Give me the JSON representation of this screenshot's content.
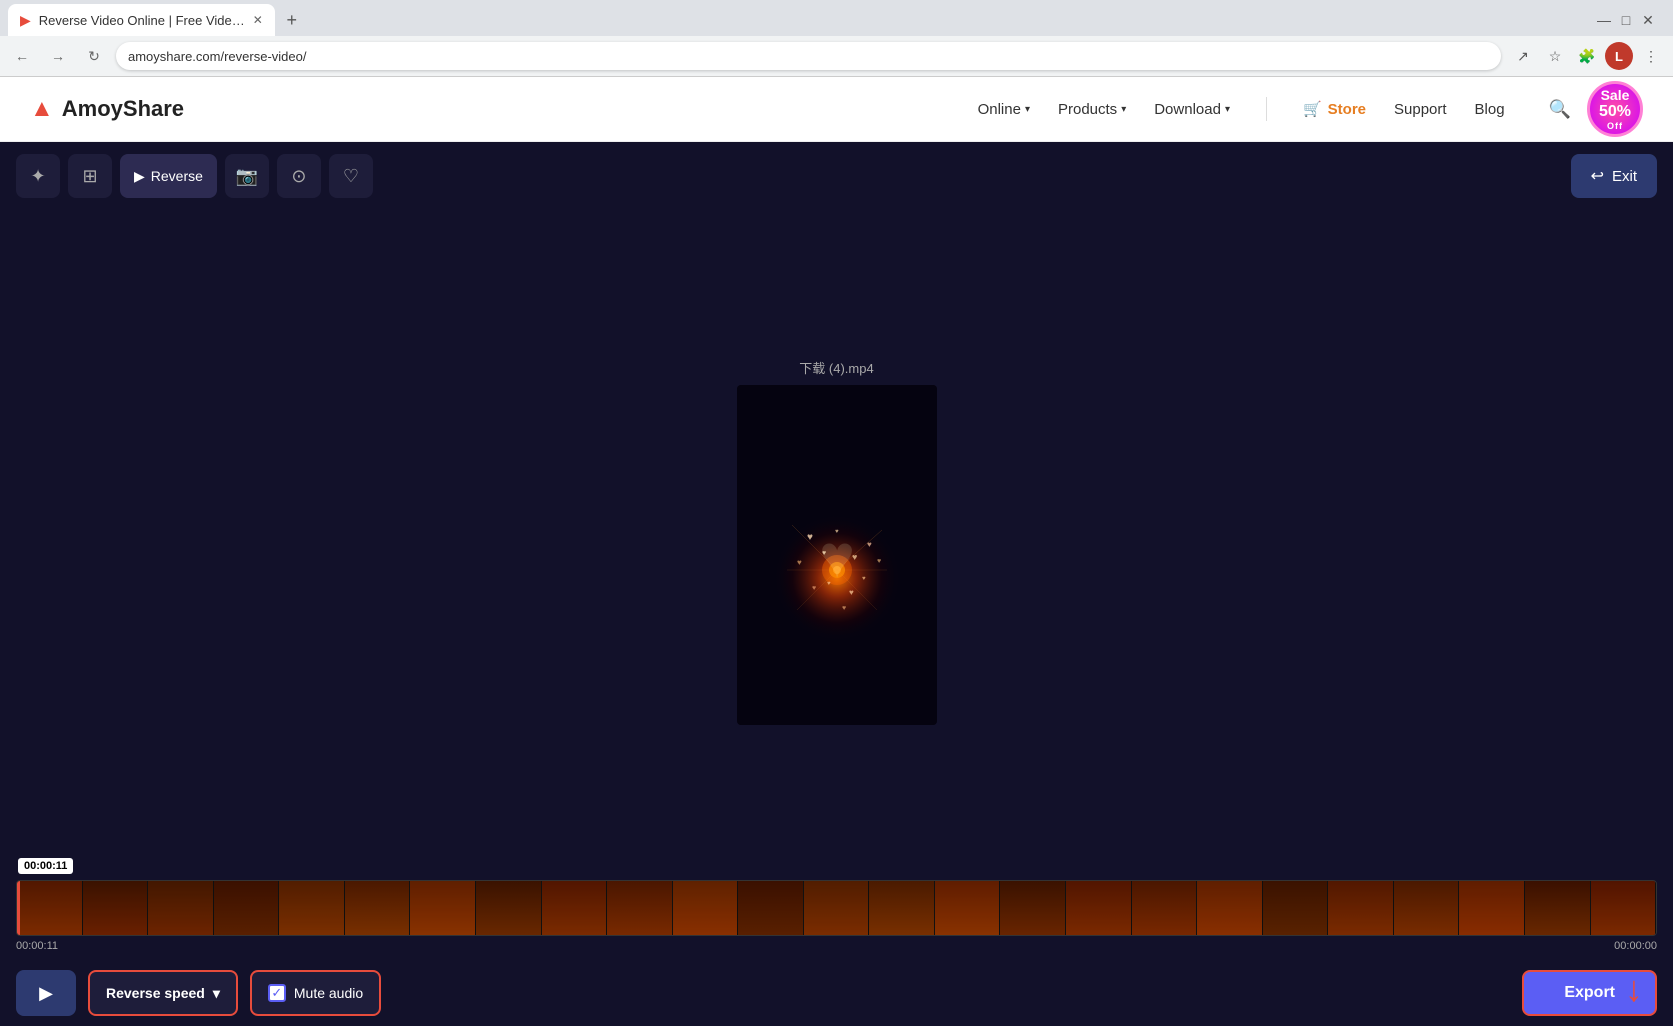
{
  "browser": {
    "tab_title": "Reverse Video Online | Free Vide…",
    "address": "amoyshare.com/reverse-video/",
    "new_tab_label": "+",
    "profile_initial": "L"
  },
  "header": {
    "logo_text": "AmoyShare",
    "nav": {
      "online": "Online",
      "products": "Products",
      "download": "Download",
      "store": "Store",
      "support": "Support",
      "blog": "Blog"
    },
    "sale_text": "Sale",
    "sale_percent": "50%",
    "sale_off": "Off"
  },
  "toolbar": {
    "ai_label": "✦",
    "crop_label": "⊡",
    "reverse_label": "Reverse",
    "screenshot_label": "⎙",
    "record_label": "⊙",
    "favorite_label": "♡",
    "exit_label": "Exit"
  },
  "video": {
    "filename": "下载 (4).mp4"
  },
  "timeline": {
    "start_time": "00:00:11",
    "end_time": "00:00:00",
    "cursor_time": "00:00:11"
  },
  "controls": {
    "reverse_speed_label": "Reverse speed",
    "mute_audio_label": "Mute audio",
    "export_label": "Export"
  }
}
